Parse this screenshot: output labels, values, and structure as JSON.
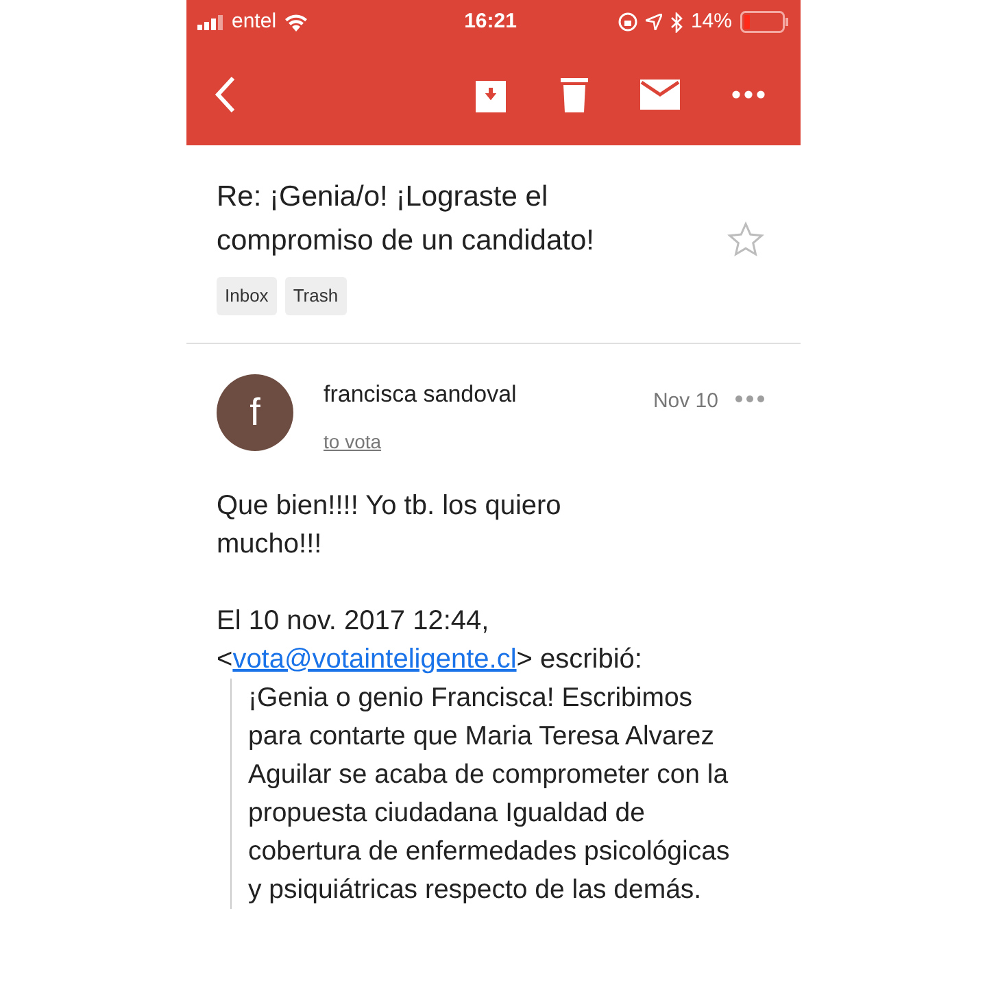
{
  "status_bar": {
    "carrier": "entel",
    "time": "16:21",
    "battery": "14%"
  },
  "subject": "Re: ¡Genia/o! ¡Lograste el compromiso de un candidato!",
  "starred": false,
  "labels": [
    "Inbox",
    "Trash"
  ],
  "message": {
    "avatar": "f",
    "sender": "francisca sandoval",
    "recipient": "to vota",
    "date": "Nov 10",
    "body": "Que bien!!!! Yo tb. los quiero mucho!!!",
    "quote_header": {
      "before": "El 10 nov. 2017 12:44, <",
      "link": "vota@votainteligente.cl",
      "after": "> escribió:"
    },
    "quote": "¡Genia o genio Francisca! Escribimos para contarte que Maria Teresa Alvarez Aguilar se acaba de comprometer con la propuesta ciudadana Igualdad de cobertura de enfermedades psicológicas y psiquiátricas respecto de las demás."
  }
}
